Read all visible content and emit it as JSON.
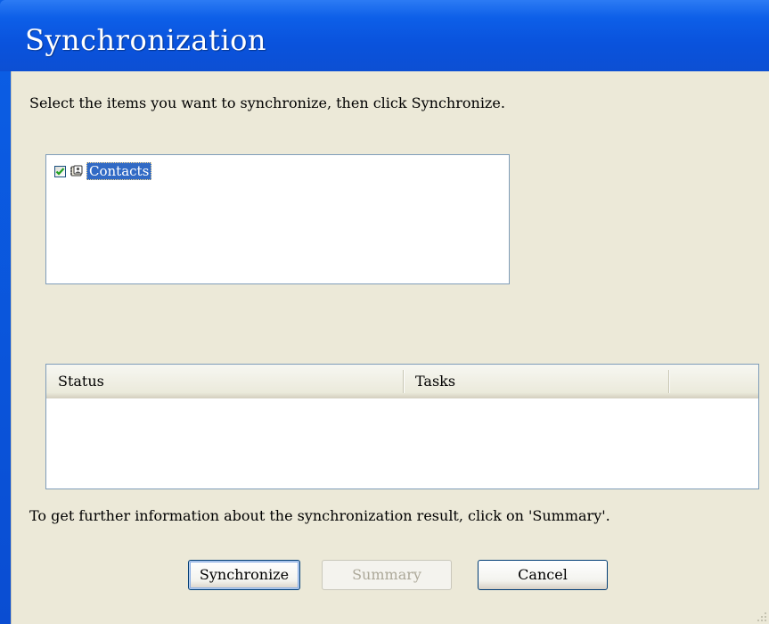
{
  "window": {
    "title": "Synchronization"
  },
  "instruction": "Select the items you want to synchronize, then click Synchronize.",
  "sync_items": [
    {
      "label": "Contacts",
      "checked": true,
      "icon": "contacts-icon",
      "selected": true
    }
  ],
  "status_table": {
    "columns": [
      "Status",
      "Tasks"
    ],
    "rows": []
  },
  "info_text": "To get further information about the synchronization result, click on 'Summary'.",
  "buttons": {
    "synchronize": "Synchronize",
    "summary": "Summary",
    "cancel": "Cancel"
  },
  "colors": {
    "title_bar": "#0a53dd",
    "dialog_background": "#ece9d8",
    "selection_highlight": "#316ac5",
    "disabled_text": "#aca899"
  }
}
